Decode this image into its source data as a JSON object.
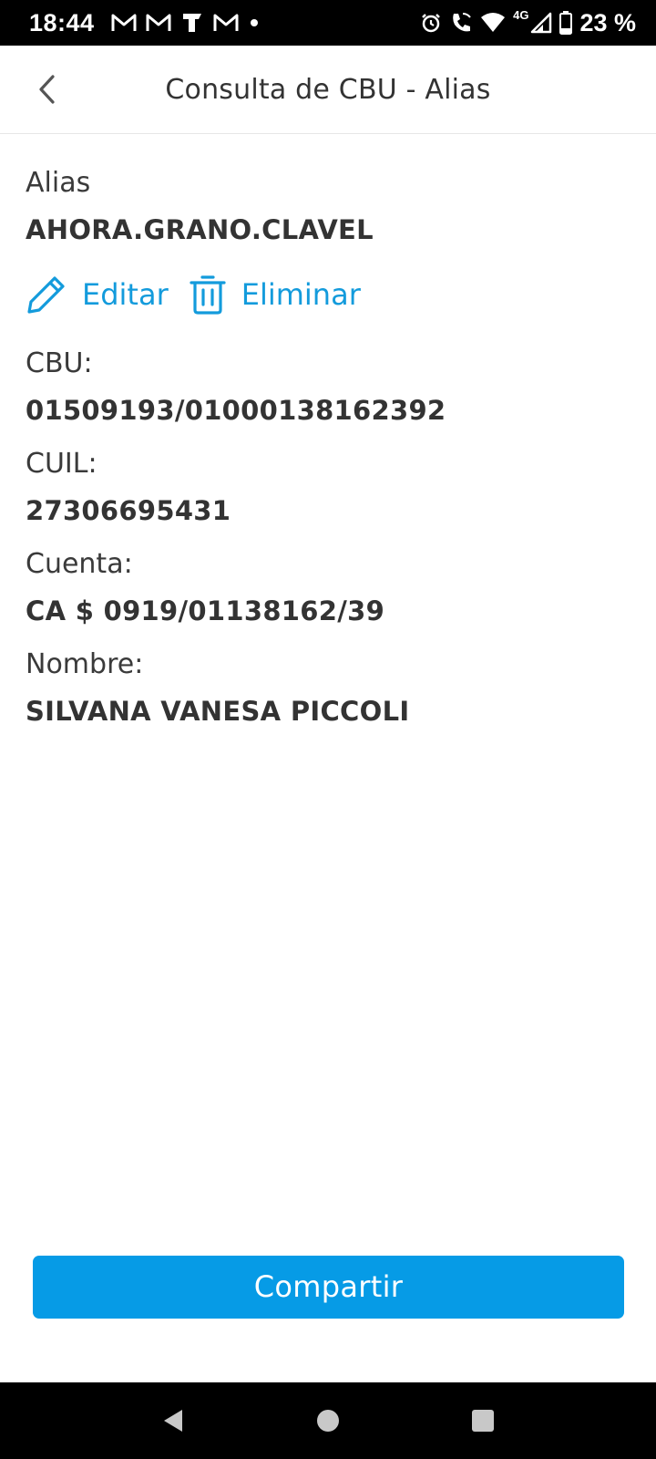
{
  "status_bar": {
    "time": "18:44",
    "notifications": [
      "gmail-icon",
      "gmail-icon",
      "app-t-icon",
      "gmail-icon",
      "dot-icon"
    ],
    "network": "4G",
    "battery": "23 %"
  },
  "header": {
    "title": "Consulta de CBU - Alias"
  },
  "details": {
    "alias_label": "Alias",
    "alias_value": "AHORA.GRANO.CLAVEL",
    "edit_label": "Editar",
    "delete_label": "Eliminar",
    "cbu_label": "CBU:",
    "cbu_value": "01509193/01000138162392",
    "cuil_label": "CUIL:",
    "cuil_value": "27306695431",
    "cuenta_label": "Cuenta:",
    "cuenta_value": "CA $ 0919/01138162/39",
    "nombre_label": "Nombre:",
    "nombre_value": "SILVANA VANESA PICCOLI"
  },
  "footer": {
    "share_label": "Compartir"
  },
  "colors": {
    "accent": "#139bdc",
    "button": "#069be6",
    "text": "#333333"
  }
}
